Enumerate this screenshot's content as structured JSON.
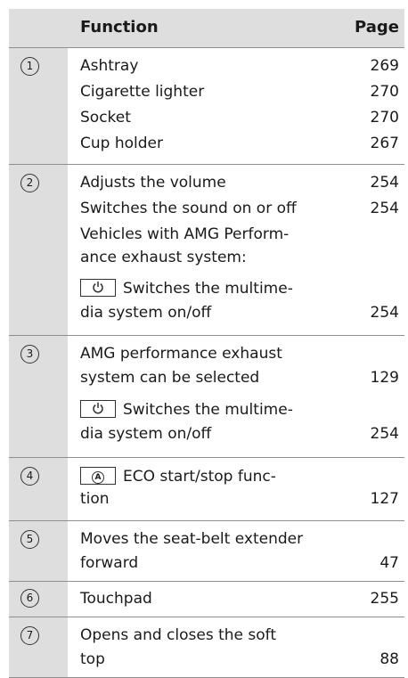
{
  "header": {
    "function_label": "Function",
    "page_label": "Page"
  },
  "rows": [
    {
      "num": "1",
      "items": [
        {
          "text": "Ashtray",
          "page": "269"
        },
        {
          "text": "Cigarette lighter",
          "page": "270"
        },
        {
          "text": "Socket",
          "page": "270"
        },
        {
          "text": "Cup holder",
          "page": "267"
        }
      ]
    },
    {
      "num": "2",
      "items": [
        {
          "text": "Adjusts the volume",
          "page": "254"
        },
        {
          "text": "Switches the sound on or off",
          "page": "254"
        },
        {
          "text": "Vehicles with AMG Perform-",
          "page": ""
        },
        {
          "text": "ance exhaust system:",
          "page": ""
        },
        {
          "text": "Switches the multime-",
          "page": "",
          "key": "power"
        },
        {
          "text": "dia system on/off",
          "page": "254"
        }
      ]
    },
    {
      "num": "3",
      "items": [
        {
          "text": "AMG performance exhaust",
          "page": ""
        },
        {
          "text": "system can be selected",
          "page": "129"
        },
        {
          "text": "Switches the multime-",
          "page": "",
          "key": "power"
        },
        {
          "text": "dia system on/off",
          "page": "254"
        }
      ]
    },
    {
      "num": "4",
      "items": [
        {
          "text": "ECO start/stop func-",
          "page": "",
          "key": "auto"
        },
        {
          "text": "tion",
          "page": "127"
        }
      ]
    },
    {
      "num": "5",
      "items": [
        {
          "text": "Moves the seat-belt extender",
          "page": ""
        },
        {
          "text": "forward",
          "page": "47"
        }
      ]
    },
    {
      "num": "6",
      "items": [
        {
          "text": "Touchpad",
          "page": "255"
        }
      ]
    },
    {
      "num": "7",
      "items": [
        {
          "text": "Opens and closes the soft",
          "page": ""
        },
        {
          "text": "top",
          "page": "88"
        }
      ]
    }
  ],
  "icons": {
    "power": "power-icon",
    "auto": "eco-start-stop-icon"
  },
  "colors": {
    "header_bg": "#dedede",
    "number_column_bg": "#dedede",
    "row_divider": "#8f8f8f"
  }
}
